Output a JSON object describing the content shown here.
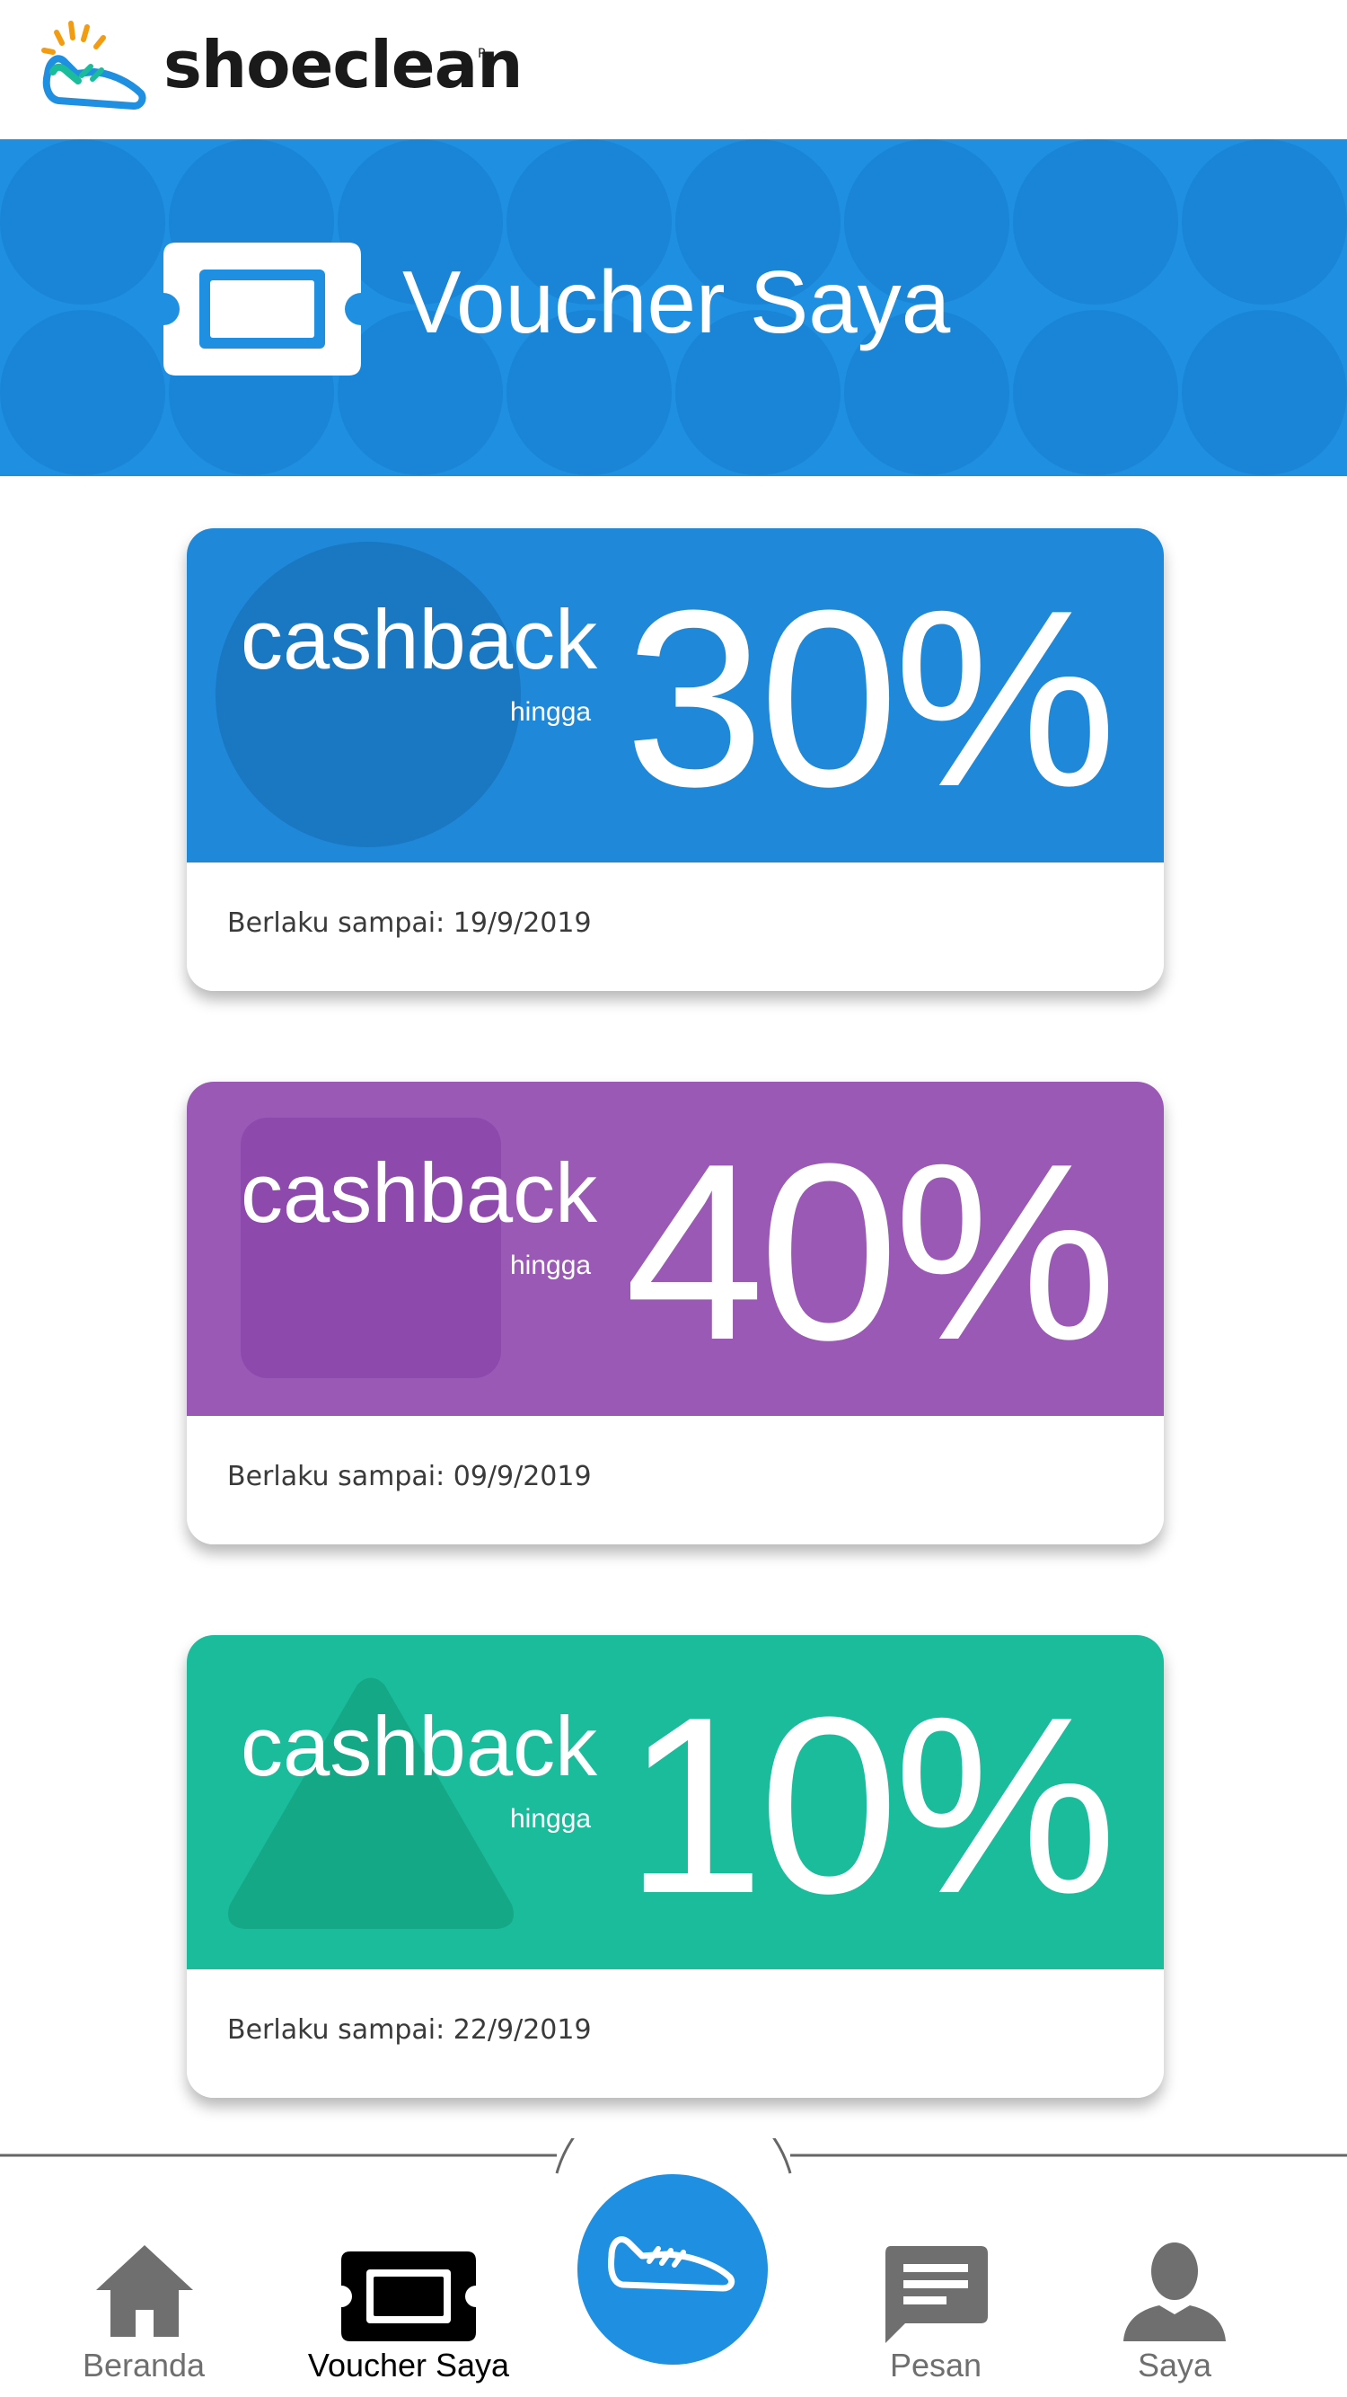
{
  "app": {
    "brand": "shoeclean",
    "brand_mark": "R"
  },
  "banner": {
    "title": "Voucher Saya",
    "icon": "ticket-icon",
    "color": "#1f8fe1"
  },
  "vouchers": [
    {
      "label": "cashback",
      "sub": "hingga",
      "value": "30%",
      "date": "Berlaku sampai: 19/9/2019",
      "color": "#1f88d9",
      "shape": "circle"
    },
    {
      "label": "cashback",
      "sub": "hingga",
      "value": "40%",
      "date": "Berlaku sampai: 09/9/2019",
      "color": "#9b59b6",
      "shape": "square"
    },
    {
      "label": "cashback",
      "sub": "hingga",
      "value": "10%",
      "date": "Berlaku sampai: 22/9/2019",
      "color": "#1abc9c",
      "shape": "triangle"
    }
  ],
  "nav": {
    "items": [
      {
        "label": "Beranda",
        "icon": "home-icon",
        "active": false
      },
      {
        "label": "Voucher Saya",
        "icon": "ticket-icon",
        "active": true
      },
      {
        "label": "Pesan",
        "icon": "chat-icon",
        "active": false
      },
      {
        "label": "Saya",
        "icon": "person-icon",
        "active": false
      }
    ],
    "fab_icon": "shoe-icon",
    "inactive_color": "#6f6f6f",
    "active_color": "#000000"
  }
}
